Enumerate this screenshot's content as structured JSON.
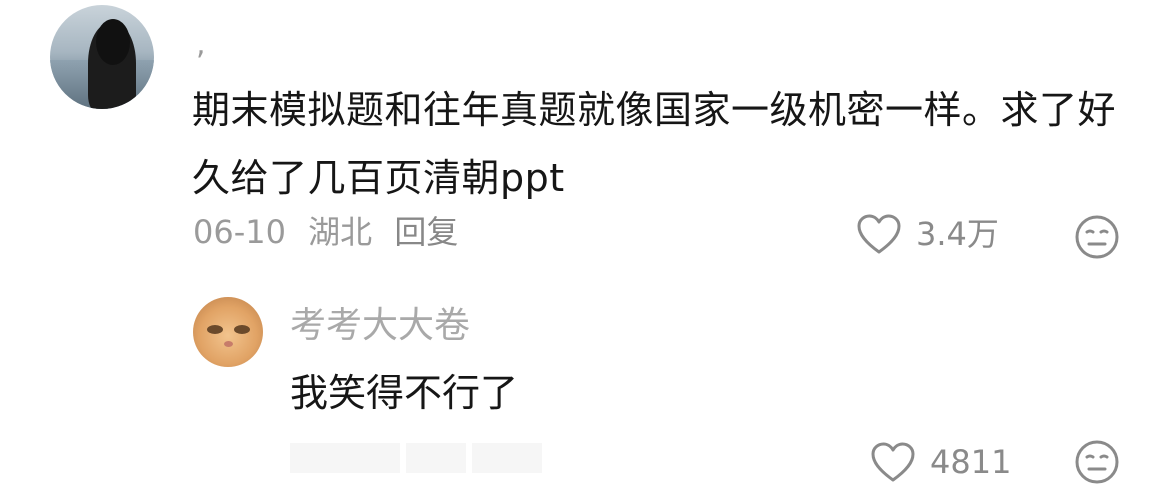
{
  "comment": {
    "username": ",",
    "text": "期末模拟题和往年真题就像国家一级机密一样。求了好久给了几百页清朝ppt",
    "date": "06-10",
    "location": "湖北",
    "reply_label": "回复",
    "likes": "3.4万"
  },
  "reply": {
    "username": "考考大大卷",
    "text": "我笑得不行了",
    "likes": "4811"
  },
  "icons": {
    "like": "heart-outline-icon",
    "dislike": "neutral-face-icon"
  }
}
